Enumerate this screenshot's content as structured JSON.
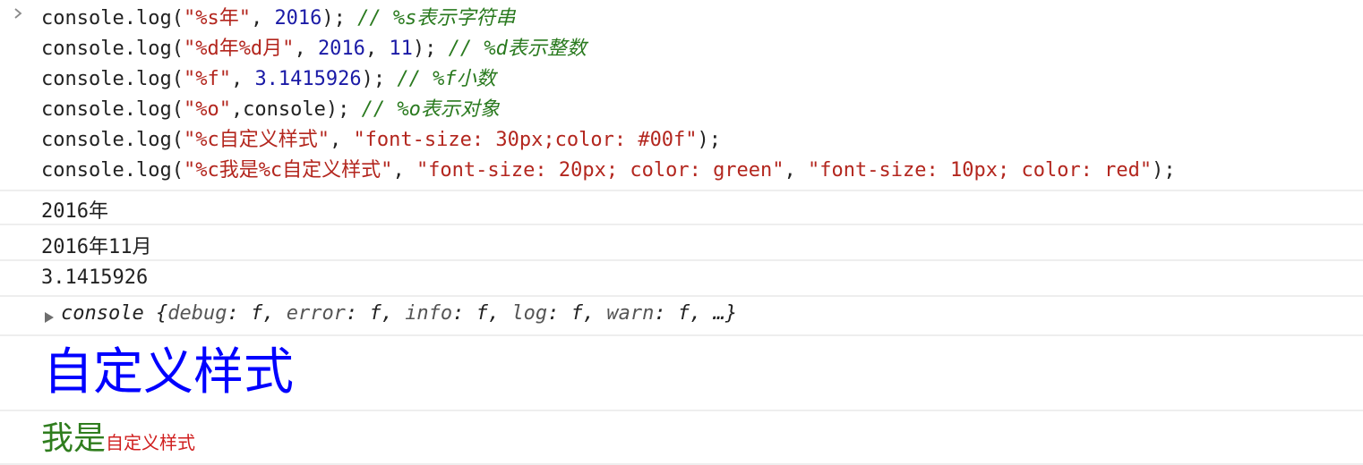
{
  "colors": {
    "string": "#b3261e",
    "number": "#1a1aa6",
    "comment": "#2a7a1f",
    "styled_blue": "#0000ff",
    "styled_green": "#2f7d1e",
    "styled_red": "#d01f1f"
  },
  "icons": {
    "prompt": "chevron-right-icon",
    "expand": "expand-triangle-icon"
  },
  "code_lines": [
    {
      "tokens": [
        {
          "t": "plain",
          "v": "console.log("
        },
        {
          "t": "str",
          "v": "\"%s年\""
        },
        {
          "t": "plain",
          "v": ", "
        },
        {
          "t": "num",
          "v": "2016"
        },
        {
          "t": "plain",
          "v": "); "
        },
        {
          "t": "comment",
          "v": "// %s表示字符串"
        }
      ]
    },
    {
      "tokens": [
        {
          "t": "plain",
          "v": "console.log("
        },
        {
          "t": "str",
          "v": "\"%d年%d月\""
        },
        {
          "t": "plain",
          "v": ", "
        },
        {
          "t": "num",
          "v": "2016"
        },
        {
          "t": "plain",
          "v": ", "
        },
        {
          "t": "num",
          "v": "11"
        },
        {
          "t": "plain",
          "v": "); "
        },
        {
          "t": "comment",
          "v": "// %d表示整数"
        }
      ]
    },
    {
      "tokens": [
        {
          "t": "plain",
          "v": "console.log("
        },
        {
          "t": "str",
          "v": "\"%f\""
        },
        {
          "t": "plain",
          "v": ", "
        },
        {
          "t": "num",
          "v": "3.1415926"
        },
        {
          "t": "plain",
          "v": "); "
        },
        {
          "t": "comment",
          "v": "// %f小数"
        }
      ]
    },
    {
      "tokens": [
        {
          "t": "plain",
          "v": "console.log("
        },
        {
          "t": "str",
          "v": "\"%o\""
        },
        {
          "t": "plain",
          "v": ",console); "
        },
        {
          "t": "comment",
          "v": "// %o表示对象"
        }
      ]
    },
    {
      "tokens": [
        {
          "t": "plain",
          "v": "console.log("
        },
        {
          "t": "str",
          "v": "\"%c自定义样式\""
        },
        {
          "t": "plain",
          "v": ", "
        },
        {
          "t": "str",
          "v": "\"font-size: 30px;color: #00f\""
        },
        {
          "t": "plain",
          "v": ");"
        }
      ]
    },
    {
      "tokens": [
        {
          "t": "plain",
          "v": "console.log("
        },
        {
          "t": "str",
          "v": "\"%c我是%c自定义样式\""
        },
        {
          "t": "plain",
          "v": ", "
        },
        {
          "t": "str",
          "v": "\"font-size: 20px; color: green\""
        },
        {
          "t": "plain",
          "v": ", "
        },
        {
          "t": "str",
          "v": "\"font-size: 10px; color: red\""
        },
        {
          "t": "plain",
          "v": ");"
        }
      ]
    }
  ],
  "outputs": {
    "line1": "2016年",
    "line2": "2016年11月",
    "line3": "3.1415926",
    "object": {
      "name": "console",
      "open": " {",
      "props": [
        {
          "key": "debug",
          "val": "f"
        },
        {
          "key": "error",
          "val": "f"
        },
        {
          "key": "info",
          "val": "f"
        },
        {
          "key": "log",
          "val": "f"
        },
        {
          "key": "warn",
          "val": "f"
        }
      ],
      "more": "…}"
    },
    "styled_big": "自定义样式",
    "styled_mixed": {
      "green_part": "我是",
      "red_part": "自定义样式"
    }
  }
}
